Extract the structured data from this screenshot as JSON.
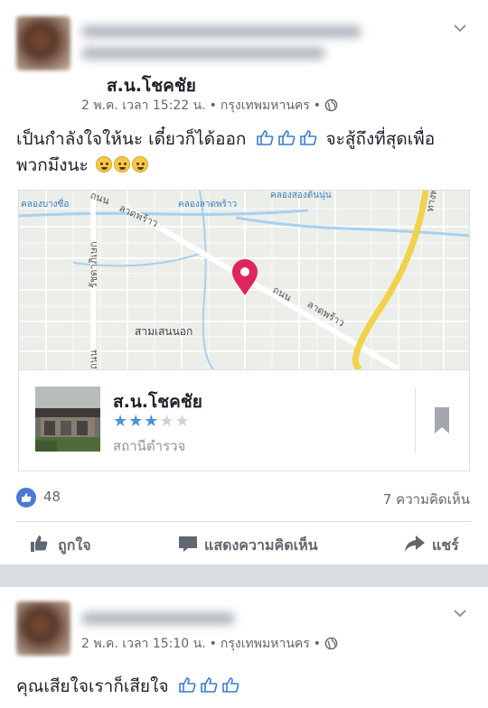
{
  "post1": {
    "checkin_place": "ส.น.โชคชัย",
    "meta": {
      "date": "2 พ.ค. เวลา 15:22 น.",
      "location": "กรุงเทพมหานคร"
    },
    "body_line1": "เป็นกำลังใจให้นะ เดี๋ยวก็ได้ออก",
    "body_line1_suffix": "จะสู้ถึงที่สุดเพื่อ",
    "body_line2": "พวกมึงนะ",
    "map": {
      "labels": {
        "canal_bangsue": "คลองบางซื่อ",
        "canal_latphrao": "คลองลาดพร้าว",
        "canal_songton": "คลองสองต้นนุ่น",
        "road_top": "ถนน",
        "latphrao_top": "ลาดพร้าว",
        "road_mid": "ถนน",
        "latphrao_mid": "ลาดพร้าว",
        "ratchada": "รัชดาภิเษก",
        "samsen": "สามเสนนอก",
        "road_left": "ถนน",
        "expressway": "ทางพ"
      }
    },
    "place": {
      "name": "ส.น.โชคชัย",
      "rating": 3,
      "rating_max": 5,
      "category": "สถานีตำรวจ"
    },
    "likes_count": "48",
    "comments_count": "7 ความคิดเห็น",
    "actions": {
      "like": "ถูกใจ",
      "comment": "แสดงความคิดเห็น",
      "share": "แชร์"
    }
  },
  "post2": {
    "meta": {
      "date": "2 พ.ค. เวลา 15:10 น.",
      "location": "กรุงเทพมหานคร"
    },
    "body": "คุณเสียใจเราก็เสียใจ"
  },
  "colors": {
    "brand_blue": "#4a78d6",
    "pin": "#e0245e",
    "star": "#4a90e2",
    "expressway": "#f2d24b",
    "separator": "#dadde1"
  },
  "icons": [
    "chevron-down-icon",
    "globe-icon",
    "thumbs-up-emoji",
    "crying-emoji",
    "map-pin-icon",
    "bookmark-icon",
    "like-icon",
    "comment-icon",
    "share-icon"
  ]
}
